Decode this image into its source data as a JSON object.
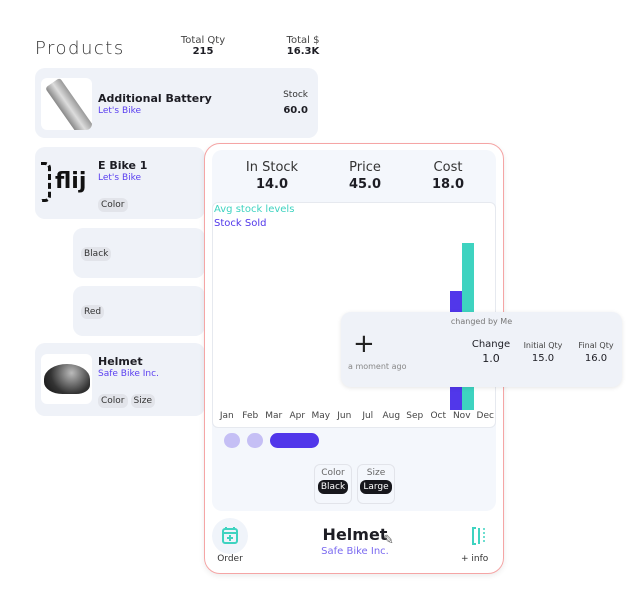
{
  "header": {
    "title": "Products",
    "total_qty_label": "Total Qty",
    "total_qty": "215",
    "total_amount_label": "Total $",
    "total_amount": "16.3K"
  },
  "products": [
    {
      "name": "Additional Battery",
      "vendor": "Let's Bike",
      "stock_label": "Stock",
      "stock": "60.0"
    },
    {
      "name": "E Bike 1",
      "vendor": "Let's Bike",
      "logo_text": "flij",
      "chips": [
        "Color"
      ],
      "variants": [
        "Black",
        "Red"
      ]
    },
    {
      "name": "Helmet",
      "vendor": "Safe Bike Inc.",
      "chips": [
        "Color",
        "Size"
      ]
    }
  ],
  "detail": {
    "stats": [
      {
        "label": "In Stock",
        "value": "14.0"
      },
      {
        "label": "Price",
        "value": "45.0"
      },
      {
        "label": "Cost",
        "value": "18.0"
      }
    ],
    "options": [
      {
        "label": "Color",
        "value": "Black"
      },
      {
        "label": "Size",
        "value": "Large"
      }
    ],
    "name": "Helmet",
    "vendor": "Safe Bike Inc.",
    "order_label": "Order",
    "info_label": "+ info",
    "colors": {
      "border": "#f5a5a5",
      "accent": "#3ed3c0",
      "primary": "#5137ea"
    }
  },
  "chart_data": {
    "type": "bar",
    "categories": [
      "Jan",
      "Feb",
      "Mar",
      "Apr",
      "May",
      "Jun",
      "Jul",
      "Aug",
      "Sep",
      "Oct",
      "Nov",
      "Dec"
    ],
    "series": [
      {
        "name": "Stock Sold",
        "color": "#5137ea",
        "values": [
          0,
          0,
          0,
          0,
          0,
          0,
          0,
          0,
          0,
          0,
          0.71,
          0
        ]
      },
      {
        "name": "Avg stock levels",
        "color": "#3ed3c0",
        "values": [
          0,
          0,
          0,
          0,
          0,
          0,
          0,
          0,
          0,
          0,
          1.0,
          0
        ]
      }
    ],
    "legend": "top-left",
    "grid": false
  },
  "tooltip": {
    "title": "changed by Me",
    "time": "a moment ago",
    "change_label": "Change",
    "change": "1.0",
    "initial_label": "Initial Qty",
    "initial": "15.0",
    "final_label": "Final Qty",
    "final": "16.0"
  }
}
